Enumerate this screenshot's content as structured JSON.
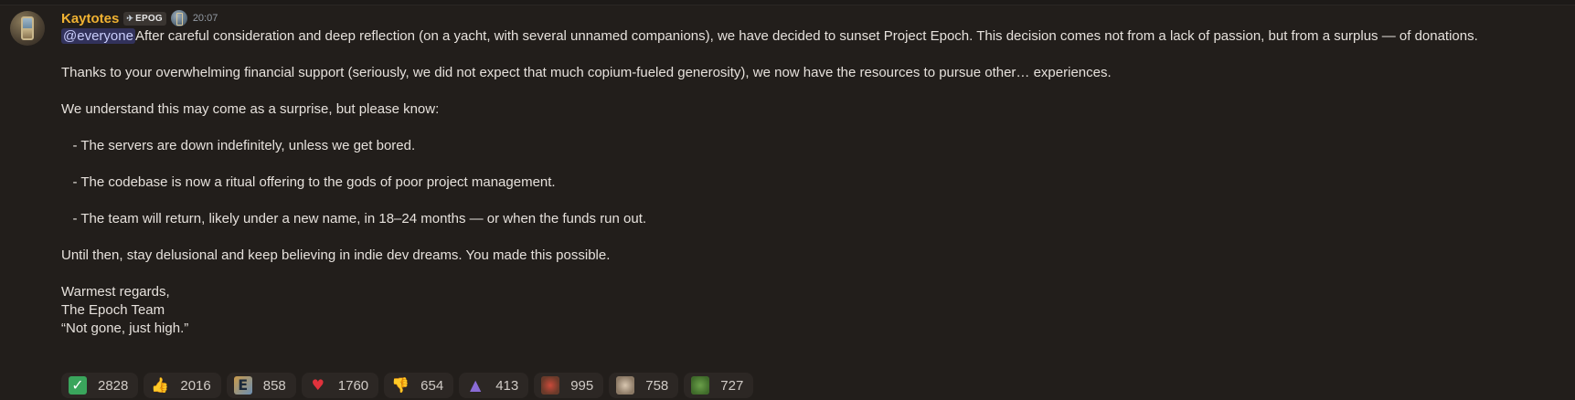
{
  "message": {
    "author": "Kaytotes",
    "tag": {
      "icon": "rocket-icon",
      "label": "EPOG"
    },
    "badge_icon": "hourglass-badge-icon",
    "timestamp": "20:07",
    "mention": "@everyone",
    "lines": [
      "After careful consideration and deep reflection (on a yacht, with several unnamed companions), we have decided to sunset Project Epoch. This decision comes not from a lack of passion, but from a surplus — of donations.",
      "",
      "Thanks to your overwhelming financial support (seriously, we did not expect that much copium-fueled generosity), we now have the resources to pursue other… experiences.",
      "",
      "We understand this may come as a surprise, but please know:",
      "",
      "   - The servers are down indefinitely, unless we get bored.",
      "",
      "   - The codebase is now a ritual offering to the gods of poor project management.",
      "",
      "   - The team will return, likely under a new name, in 18–24 months — or when the funds run out.",
      "",
      "Until then, stay delusional and keep believing in indie dev dreams. You made this possible.",
      "",
      "Warmest regards,",
      "The Epoch Team",
      "“Not gone, just high.”"
    ]
  },
  "reactions": [
    {
      "icon": "check-mark-icon",
      "glyph": "✓",
      "count": "2828"
    },
    {
      "icon": "thumbs-up-icon",
      "glyph": "👍",
      "count": "2016"
    },
    {
      "icon": "epoch-emote-icon",
      "glyph": "E",
      "count": "858"
    },
    {
      "icon": "heart-icon",
      "glyph": "♥",
      "count": "1760"
    },
    {
      "icon": "thumbs-down-icon",
      "glyph": "👎",
      "count": "654"
    },
    {
      "icon": "wizard-emote-icon",
      "glyph": "▲",
      "count": "413"
    },
    {
      "icon": "hug-emote-icon",
      "glyph": "",
      "count": "995"
    },
    {
      "icon": "cat-emote-icon",
      "glyph": "",
      "count": "758"
    },
    {
      "icon": "pepe-emote-icon",
      "glyph": "",
      "count": "727"
    }
  ],
  "colors": {
    "background": "#221e1b",
    "username": "#f0b232",
    "mention_bg": "#3d4270",
    "reaction_bg": "#2c2724"
  }
}
